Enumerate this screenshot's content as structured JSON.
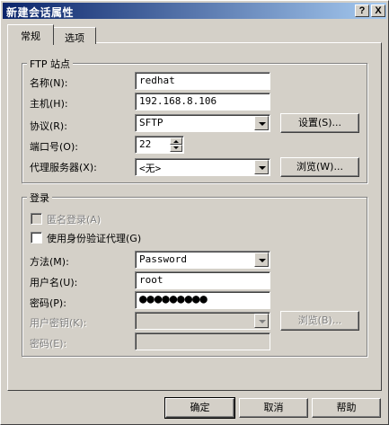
{
  "window": {
    "title": "新建会话属性",
    "help_label": "?",
    "close_label": "X"
  },
  "tabs": [
    {
      "label": "常规",
      "active": true
    },
    {
      "label": "选项",
      "active": false
    }
  ],
  "ftp_group": {
    "legend": "FTP 站点",
    "name": {
      "label": "名称(N):",
      "value": "redhat"
    },
    "host": {
      "label": "主机(H):",
      "value": "192.168.8.106"
    },
    "protocol": {
      "label": "协议(R):",
      "value": "SFTP",
      "settings_button": "设置(S)..."
    },
    "port": {
      "label": "端口号(O):",
      "value": "22"
    },
    "proxy": {
      "label": "代理服务器(X):",
      "value": "<无>",
      "browse_button": "浏览(W)..."
    }
  },
  "login_group": {
    "legend": "登录",
    "anonymous": {
      "label": "匿名登录(A)",
      "checked": false,
      "enabled": false
    },
    "auth_agent": {
      "label": "使用身份验证代理(G)",
      "checked": false,
      "enabled": true
    },
    "method": {
      "label": "方法(M):",
      "value": "Password"
    },
    "username": {
      "label": "用户名(U):",
      "value": "root"
    },
    "password": {
      "label": "密码(P):",
      "value": "●●●●●●●●●"
    },
    "user_key": {
      "label": "用户密钥(K):",
      "value": "",
      "browse_button": "浏览(B)..."
    },
    "passphrase": {
      "label": "密码(E):",
      "value": ""
    }
  },
  "footer": {
    "ok": "确定",
    "cancel": "取消",
    "help": "帮助"
  }
}
